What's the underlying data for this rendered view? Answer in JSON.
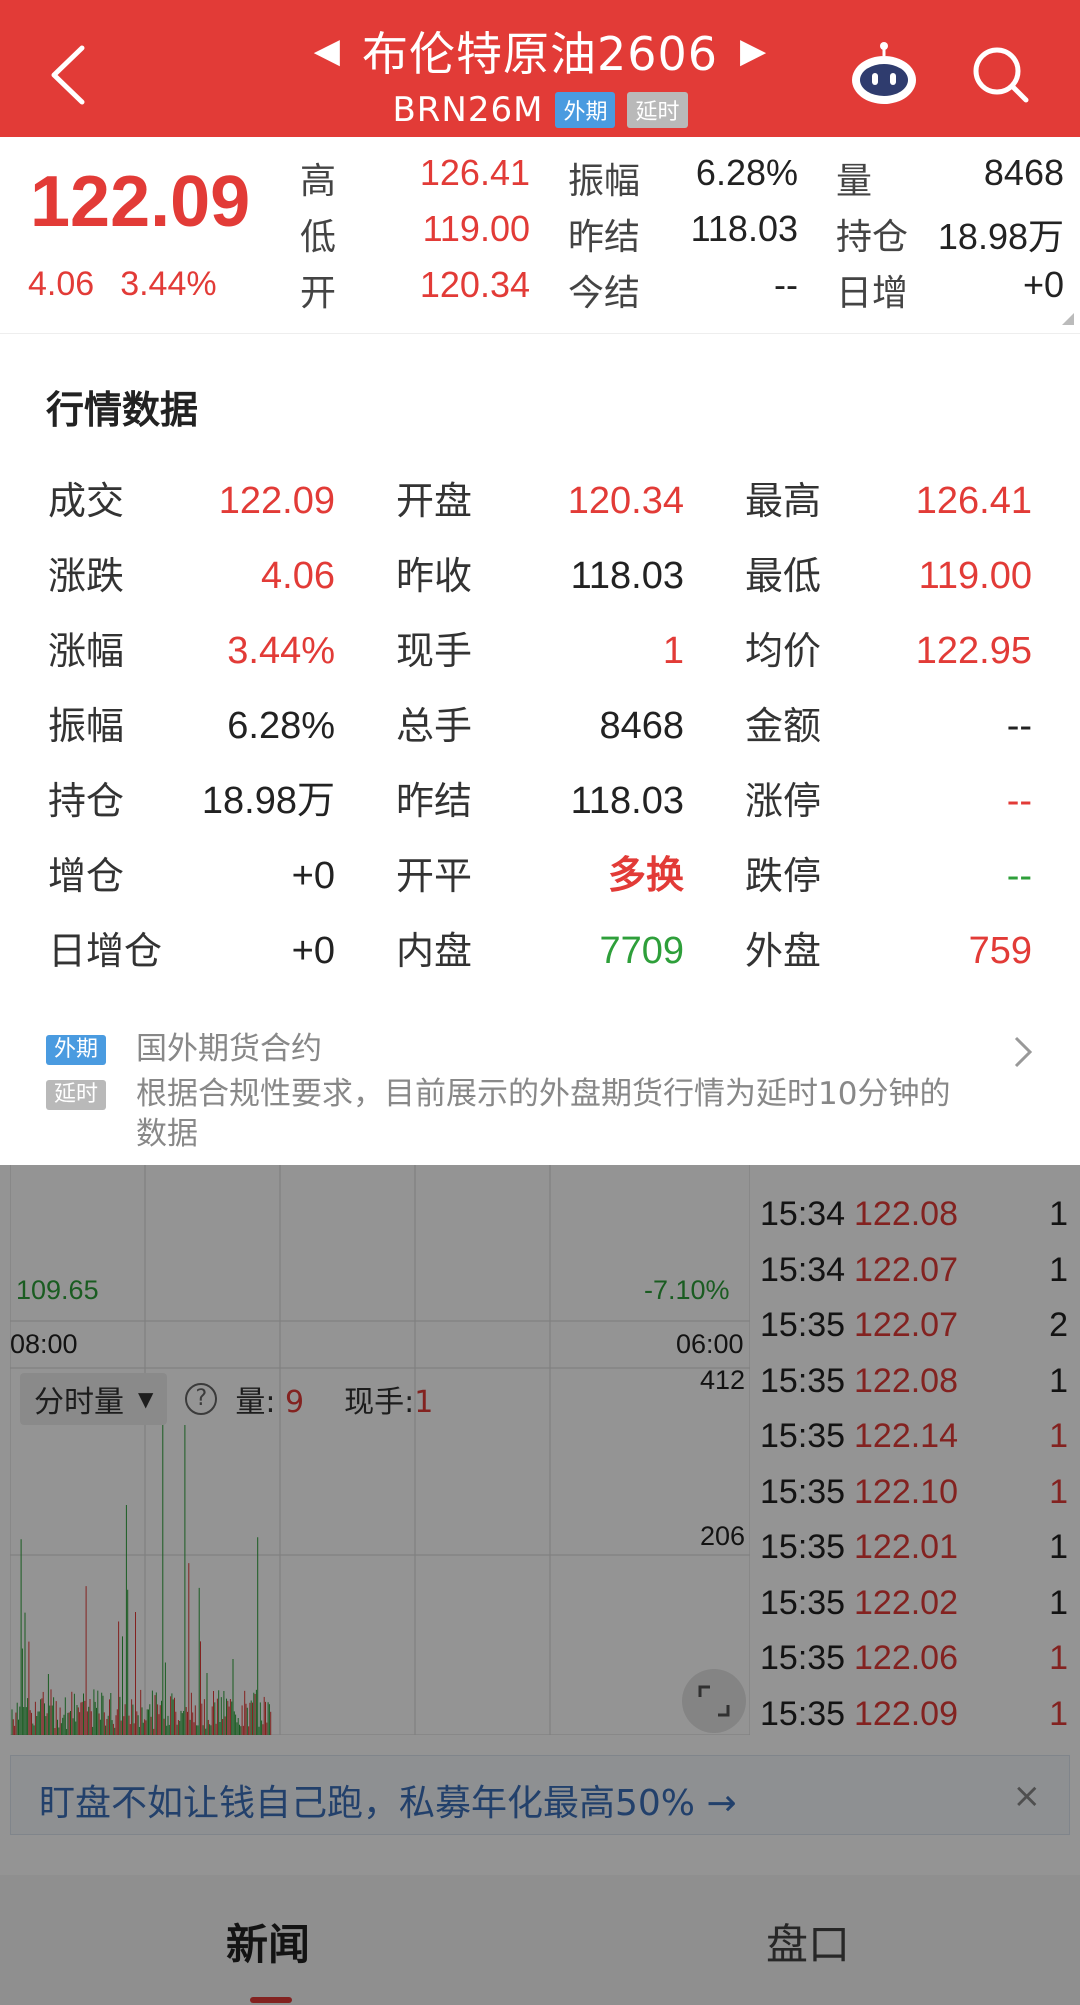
{
  "header": {
    "title": "布伦特原油2606",
    "code": "BRN26M",
    "tag_foreign": "外期",
    "tag_delay": "延时",
    "prev_arrow": "◀",
    "next_arrow": "▶"
  },
  "quote": {
    "price": "122.09",
    "change": "4.06",
    "change_pct": "3.44%",
    "cells": [
      {
        "label": "高",
        "value": "126.41",
        "color": "red"
      },
      {
        "label": "振幅",
        "value": "6.28%",
        "color": "dark"
      },
      {
        "label": "量",
        "value": "8468",
        "color": "dark"
      },
      {
        "label": "低",
        "value": "119.00",
        "color": "red"
      },
      {
        "label": "昨结",
        "value": "118.03",
        "color": "dark"
      },
      {
        "label": "持仓",
        "value": "18.98万",
        "color": "dark"
      },
      {
        "label": "开",
        "value": "120.34",
        "color": "red"
      },
      {
        "label": "今结",
        "value": "--",
        "color": "dark"
      },
      {
        "label": "日增",
        "value": "+0",
        "color": "dark"
      }
    ]
  },
  "panel": {
    "title": "行情数据",
    "rows": [
      [
        {
          "label": "成交",
          "value": "122.09",
          "color": "red"
        },
        {
          "label": "开盘",
          "value": "120.34",
          "color": "red"
        },
        {
          "label": "最高",
          "value": "126.41",
          "color": "red"
        }
      ],
      [
        {
          "label": "涨跌",
          "value": "4.06",
          "color": "red"
        },
        {
          "label": "昨收",
          "value": "118.03",
          "color": "dark"
        },
        {
          "label": "最低",
          "value": "119.00",
          "color": "red"
        }
      ],
      [
        {
          "label": "涨幅",
          "value": "3.44%",
          "color": "red"
        },
        {
          "label": "现手",
          "value": "1",
          "color": "red"
        },
        {
          "label": "均价",
          "value": "122.95",
          "color": "red"
        }
      ],
      [
        {
          "label": "振幅",
          "value": "6.28%",
          "color": "dark"
        },
        {
          "label": "总手",
          "value": "8468",
          "color": "dark"
        },
        {
          "label": "金额",
          "value": "--",
          "color": "dark"
        }
      ],
      [
        {
          "label": "持仓",
          "value": "18.98万",
          "color": "dark"
        },
        {
          "label": "昨结",
          "value": "118.03",
          "color": "dark"
        },
        {
          "label": "涨停",
          "value": "--",
          "color": "red"
        }
      ],
      [
        {
          "label": "增仓",
          "value": "+0",
          "color": "dark"
        },
        {
          "label": "开平",
          "value": "多换",
          "color": "red"
        },
        {
          "label": "跌停",
          "value": "--",
          "color": "green"
        }
      ],
      [
        {
          "label": "日增仓",
          "value": "+0",
          "color": "dark"
        },
        {
          "label": "内盘",
          "value": "7709",
          "color": "green"
        },
        {
          "label": "外盘",
          "value": "759",
          "color": "red"
        }
      ]
    ],
    "note_tag_foreign": "外期",
    "note_foreign_text": "国外期货合约",
    "note_tag_delay": "延时",
    "note_delay_text": "根据合规性要求，目前展示的外盘期货行情为延时10分钟的数据"
  },
  "chart": {
    "low_price": "109.65",
    "low_pct": "-7.10%",
    "time_start": "08:00",
    "time_end": "06:00",
    "vol_max": "412",
    "vol_mid": "206",
    "vol_selector": "分时量",
    "vol_label": "量:",
    "vol_value": "9",
    "hand_label": "现手:",
    "hand_value": "1"
  },
  "ticks": [
    {
      "time": "15:34",
      "price": "122.08",
      "vol": "1",
      "vol_color": "dark"
    },
    {
      "time": "15:34",
      "price": "122.07",
      "vol": "1",
      "vol_color": "dark"
    },
    {
      "time": "15:35",
      "price": "122.07",
      "vol": "2",
      "vol_color": "dark"
    },
    {
      "time": "15:35",
      "price": "122.08",
      "vol": "1",
      "vol_color": "dark"
    },
    {
      "time": "15:35",
      "price": "122.14",
      "vol": "1",
      "vol_color": "red"
    },
    {
      "time": "15:35",
      "price": "122.10",
      "vol": "1",
      "vol_color": "red"
    },
    {
      "time": "15:35",
      "price": "122.01",
      "vol": "1",
      "vol_color": "dark"
    },
    {
      "time": "15:35",
      "price": "122.02",
      "vol": "1",
      "vol_color": "dark"
    },
    {
      "time": "15:35",
      "price": "122.06",
      "vol": "1",
      "vol_color": "red"
    },
    {
      "time": "15:35",
      "price": "122.09",
      "vol": "1",
      "vol_color": "red"
    }
  ],
  "promo": {
    "text": "盯盘不如让钱自己跑，私募年化最高50% →",
    "close": "×"
  },
  "tabs": [
    "新闻",
    "盘口"
  ],
  "colors": {
    "header_red": "#e23b37",
    "up_red": "#e23b37",
    "down_green": "#2e9f3a",
    "tag_blue": "#4a9be0"
  }
}
